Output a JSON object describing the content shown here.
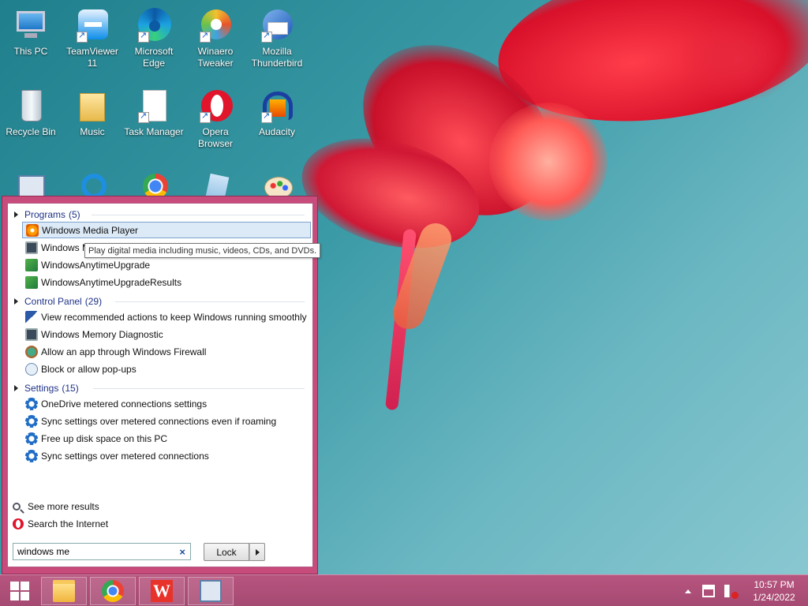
{
  "desktop": {
    "icons": [
      {
        "label": "This PC",
        "icon": "computer-icon"
      },
      {
        "label": "TeamViewer 11",
        "icon": "teamviewer-icon"
      },
      {
        "label": "Microsoft Edge",
        "icon": "edge-icon"
      },
      {
        "label": "Winaero Tweaker",
        "icon": "winaero-icon"
      },
      {
        "label": "Mozilla Thunderbird",
        "icon": "thunderbird-icon"
      },
      {
        "label": "Recycle Bin",
        "icon": "recycle-bin-icon"
      },
      {
        "label": "Music",
        "icon": "folder-icon"
      },
      {
        "label": "Task Manager",
        "icon": "document-icon"
      },
      {
        "label": "Opera Browser",
        "icon": "opera-icon"
      },
      {
        "label": "Audacity",
        "icon": "audacity-icon"
      }
    ]
  },
  "start_menu": {
    "groups": [
      {
        "title": "Programs",
        "count": "(5)",
        "items": [
          {
            "label": "Windows Media Player",
            "icon": "media-player-icon",
            "selected": true
          },
          {
            "label": "Windows Media Player Legacy",
            "icon": "monitor-icon",
            "selected": false
          },
          {
            "label": "WindowsAnytimeUpgrade",
            "icon": "upgrade-icon",
            "selected": false
          },
          {
            "label": "WindowsAnytimeUpgradeResults",
            "icon": "upgrade-icon",
            "selected": false
          }
        ]
      },
      {
        "title": "Control Panel",
        "count": "(29)",
        "items": [
          {
            "label": "View recommended actions to keep Windows running smoothly",
            "icon": "flag-icon"
          },
          {
            "label": "Windows Memory Diagnostic",
            "icon": "monitor-icon"
          },
          {
            "label": "Allow an app through Windows Firewall",
            "icon": "firewall-icon"
          },
          {
            "label": "Block or allow pop-ups",
            "icon": "popup-icon"
          }
        ]
      },
      {
        "title": "Settings",
        "count": "(15)",
        "items": [
          {
            "label": "OneDrive metered connections settings",
            "icon": "gear-icon"
          },
          {
            "label": "Sync settings over metered connections even if roaming",
            "icon": "gear-icon"
          },
          {
            "label": "Free up disk space on this PC",
            "icon": "gear-icon"
          },
          {
            "label": "Sync settings over metered connections",
            "icon": "gear-icon"
          }
        ]
      }
    ],
    "see_more": "See more results",
    "search_internet": "Search the Internet",
    "search_value": "windows me",
    "clear_glyph": "×",
    "lock_label": "Lock",
    "tooltip": "Play digital media including music, videos, CDs, and DVDs."
  },
  "taskbar": {
    "apps": [
      "file-explorer-icon",
      "chrome-icon",
      "wps-office-icon",
      "control-panel-icon"
    ],
    "wps_glyph": "W",
    "clock_time": "10:57 PM",
    "clock_date": "1/24/2022"
  }
}
